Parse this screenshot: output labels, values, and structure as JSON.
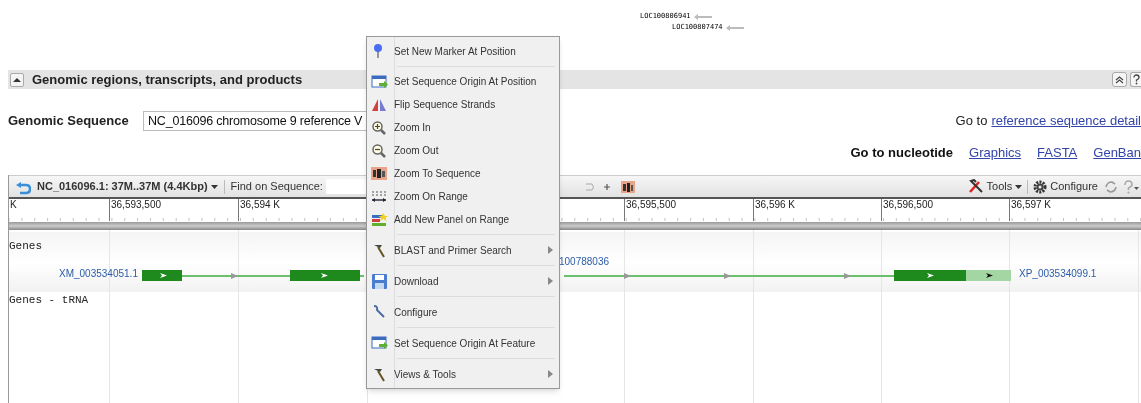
{
  "overview_labels": [
    {
      "text": "LOC100806941"
    },
    {
      "text": "LOC100807474"
    }
  ],
  "section": {
    "title": "Genomic regions, transcripts, and products",
    "expanded": true
  },
  "genomic_sequence": {
    "label": "Genomic Sequence",
    "value": "NC_016096 chromosome 9 reference V"
  },
  "goto_reference": {
    "prefix": "Go to",
    "link": "reference sequence detail"
  },
  "goto_nucleotide": {
    "label": "Go to nucleotide",
    "links": [
      "Graphics",
      "FASTA",
      "GenBan"
    ]
  },
  "toolbar": {
    "range": "NC_016096.1: 37M..37M (4.4Kbp)",
    "find_label": "Find on Sequence:",
    "tools": "Tools",
    "configure": "Configure"
  },
  "ruler": {
    "ticks": [
      "K",
      "36,593,500",
      "36,594 K",
      "36,595,500",
      "36,596 K",
      "36,596,500",
      "36,597 K"
    ]
  },
  "tracks": [
    {
      "title": "Genes",
      "labels": [
        "XM_003534051.1",
        "100788036",
        "XP_003534099.1"
      ]
    },
    {
      "title": "Genes - tRNA"
    }
  ],
  "context_menu": {
    "groups": [
      [
        {
          "label": "Set New Marker At Position",
          "kind": "action"
        }
      ],
      [
        {
          "label": "Set Sequence Origin At Position",
          "kind": "action"
        },
        {
          "label": "Flip Sequence Strands",
          "kind": "action"
        },
        {
          "label": "Zoom In",
          "kind": "action"
        },
        {
          "label": "Zoom Out",
          "kind": "action"
        },
        {
          "label": "Zoom To Sequence",
          "kind": "action"
        },
        {
          "label": "Zoom On Range",
          "kind": "action"
        },
        {
          "label": "Add New Panel on Range",
          "kind": "action"
        }
      ],
      [
        {
          "label": "BLAST and Primer Search",
          "kind": "submenu"
        }
      ],
      [
        {
          "label": "Download",
          "kind": "submenu"
        }
      ],
      [
        {
          "label": "Configure",
          "kind": "action"
        }
      ],
      [
        {
          "label": "Set Sequence Origin At Feature",
          "kind": "action"
        }
      ],
      [
        {
          "label": "Views & Tools",
          "kind": "submenu"
        }
      ]
    ]
  }
}
